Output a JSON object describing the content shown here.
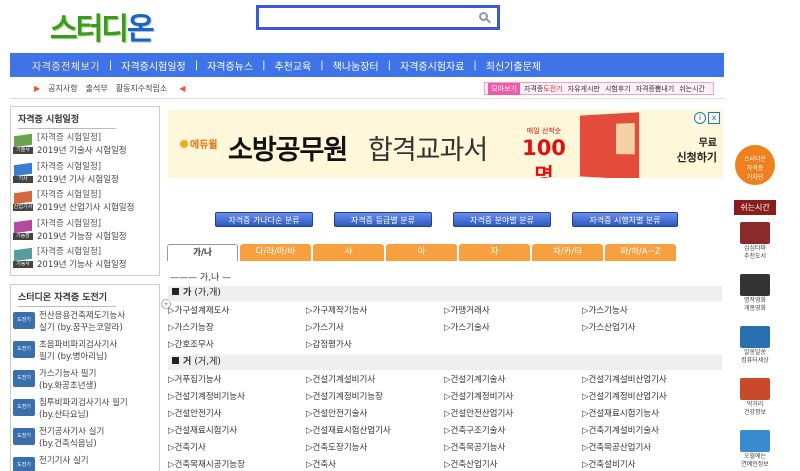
{
  "header": {
    "logo": {
      "part1": "스터디",
      "part2": "온"
    },
    "search": {
      "placeholder": "",
      "value": ""
    }
  },
  "main_nav": [
    "자격증전체보기",
    "자격증시험일정",
    "자격증뉴스",
    "추천교육",
    "책나눔장터",
    "자격증시험자료",
    "최신기출문제"
  ],
  "sub_nav": {
    "links": [
      "공지사항",
      "출석부",
      "활동지수적립소"
    ],
    "right_label": "모아보기",
    "right_items": [
      {
        "pre": "자격증",
        "red": "도전기",
        "post": ""
      },
      {
        "pre": "자유게시판",
        "red": "",
        "post": ""
      },
      {
        "pre": "시험후기",
        "red": "",
        "post": ""
      },
      {
        "pre": "자격증뽐내기",
        "red": "",
        "post": ""
      },
      {
        "pre": "쉬는시간",
        "red": "",
        "post": ""
      }
    ]
  },
  "schedule_box": {
    "title": "자격증 시험일정",
    "add": "+",
    "items": [
      {
        "cat": "[자격증 시험일정]",
        "desc": "2019년 기술사 시험일정",
        "thumb": "기술사",
        "color": "#6aa34b"
      },
      {
        "cat": "[자격증 시험일정]",
        "desc": "2019년 기사 시험일정",
        "thumb": "기사",
        "color": "#3c7bd1"
      },
      {
        "cat": "[자격증 시험일정]",
        "desc": "2019년 산업기사 시험일정",
        "thumb": "산업기사",
        "color": "#d4683c"
      },
      {
        "cat": "[자격증 시험일정]",
        "desc": "2019년 기능장 시험일정",
        "thumb": "기능장",
        "color": "#b54aa5"
      },
      {
        "cat": "[자격증 시험일정]",
        "desc": "2019년 기능사 시험일정",
        "thumb": "기능사",
        "color": "#5a9b9b"
      }
    ]
  },
  "challenge_box": {
    "title": "스터디온 자격증 도전기",
    "add": "+",
    "thumb": "도전기",
    "items": [
      {
        "l1": "전산응용건축제도기능사",
        "l2": "실기 (by.꿈꾸는코알라)"
      },
      {
        "l1": "초음파비파괴검사기사",
        "l2": "필기 (by.병아리님)"
      },
      {
        "l1": "가스기능사 필기",
        "l2": "(by.화공초년생)"
      },
      {
        "l1": "침투비파괴검사기사 필기",
        "l2": "(by.산타요님)"
      },
      {
        "l1": "전기공사기사 실기",
        "l2": "(by.건축식음님)"
      },
      {
        "l1": "전기기사 실기",
        "l2": ""
      }
    ]
  },
  "ad": {
    "brand": "에듀윌",
    "headline_bold": "소방공무원",
    "headline_rest": "합격교과서",
    "badge_small": "매일 선착순",
    "badge_big": "100명",
    "cta1": "무료",
    "cta2": "신청하기",
    "info": "i",
    "close": "x"
  },
  "category_buttons": [
    "자격증 가나다순 분류",
    "자격증 등급별 분류",
    "자격증 분야별 분류",
    "자격증 시행처별 분류"
  ],
  "tabs": [
    "가/나",
    "다/라/마/바",
    "사",
    "아",
    "자",
    "차/카/타",
    "파/하/A~Z"
  ],
  "list_heading": "——— 가,나 —",
  "sections": [
    {
      "label": "가",
      "sub": "(가,개)",
      "rows": [
        [
          "▷가구설계제도사",
          "▷가구제작기능사",
          "▷가맹거래사",
          "▷가스기능사"
        ],
        [
          "▷가스기능장",
          "▷가스기사",
          "▷가스기술사",
          "▷가스산업기사"
        ],
        [
          "▷간호조무사",
          "▷감정평가사",
          "",
          ""
        ]
      ]
    },
    {
      "label": "거",
      "sub": "(거,게)",
      "rows": [
        [
          "▷거푸집기능사",
          "▷건설기계설비기사",
          "▷건설기계기술사",
          "▷건설기계설비산업기사"
        ],
        [
          "▷건설기계정비기능사",
          "▷건설기계정비기능장",
          "▷건설기계정비기사",
          "▷건설기계정비산업기사"
        ],
        [
          "▷건설안전기사",
          "▷건설안전기술사",
          "▷건설안전산업기사",
          "▷건설재료시험기능사"
        ],
        [
          "▷건설재료시험기사",
          "▷건설재료시험산업기사",
          "▷건축구조기술사",
          "▷건축기계설비기술사"
        ],
        [
          "▷건축기사",
          "▷건축도장기능사",
          "▷건축목공기능사",
          "▷건축목공산업기사"
        ],
        [
          "▷건축목재시공기능장",
          "▷건축사",
          "▷건축산업기사",
          "▷건축설비기사"
        ]
      ]
    }
  ],
  "right_rail": {
    "logo": [
      "스터디온",
      "자격증",
      "기자단",
      "모집"
    ],
    "title": "쉬는시간",
    "items": [
      {
        "l1": "심심타파",
        "l2": "추천도서",
        "color": "#8b2a2a"
      },
      {
        "l1": "명작영화",
        "l2": "개봉영화",
        "color": "#333333"
      },
      {
        "l1": "알쏭달쏭",
        "l2": "컴퓨터세상",
        "color": "#2a6fb0"
      },
      {
        "l1": "먹거리",
        "l2": "건강정보",
        "color": "#c84a2a"
      },
      {
        "l1": "오월에는",
        "l2": "연예인정보",
        "color": "#3a8ad0"
      }
    ]
  }
}
